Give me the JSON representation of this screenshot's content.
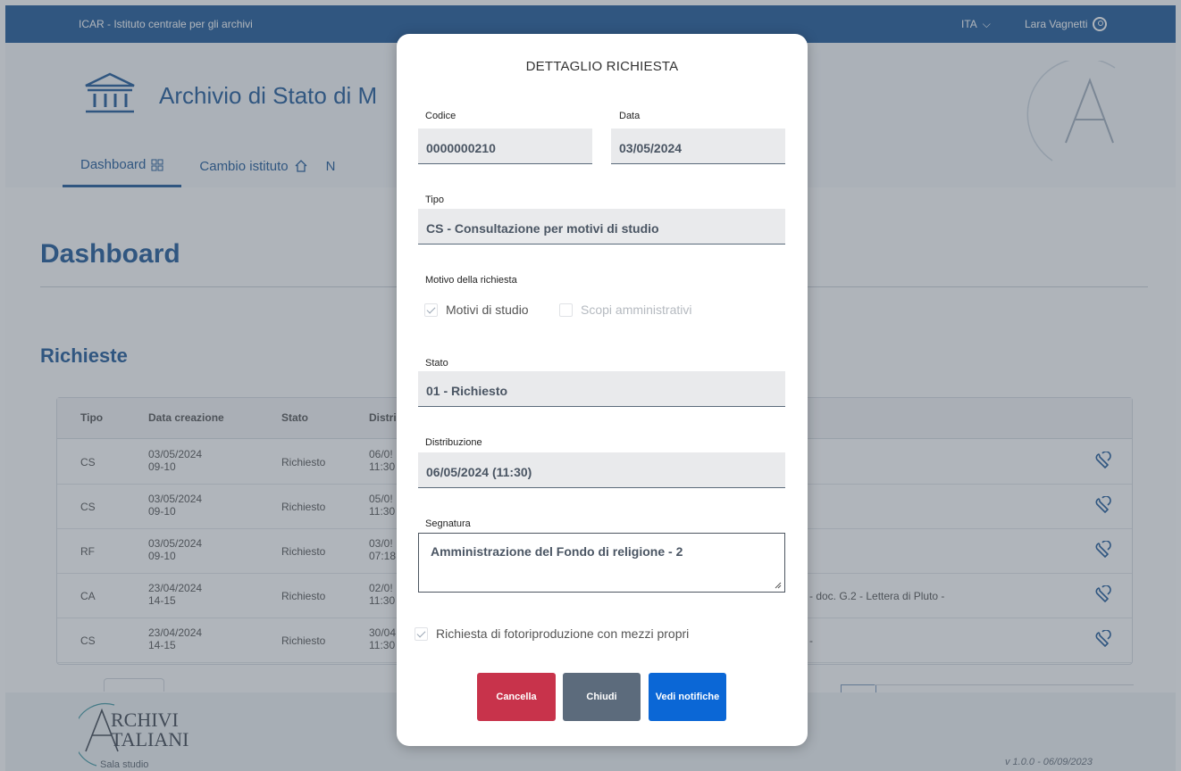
{
  "topbar": {
    "org": "ICAR - Istituto centrale per gli archivi",
    "lang": "ITA",
    "user": "Lara Vagnetti"
  },
  "header": {
    "institute": "Archivio di Stato di M"
  },
  "nav": [
    {
      "label": "Dashboard"
    },
    {
      "label": "Cambio istituto"
    },
    {
      "label": "N"
    }
  ],
  "page": {
    "title": "Dashboard",
    "section": "Richieste"
  },
  "table": {
    "headers": [
      "Tipo",
      "Data creazione",
      "Stato",
      "Distri"
    ],
    "rows": [
      {
        "tipo": "CS",
        "date": "03/05/2024",
        "time": "09-10",
        "stato": "Richiesto",
        "dist1": "06/0!",
        "dist2": "11:30",
        "extra": ""
      },
      {
        "tipo": "CS",
        "date": "03/05/2024",
        "time": "09-10",
        "stato": "Richiesto",
        "dist1": "05/0!",
        "dist2": "11:30",
        "extra": ""
      },
      {
        "tipo": "RF",
        "date": "03/05/2024",
        "time": "09-10",
        "stato": "Richiesto",
        "dist1": "03/0!",
        "dist2": "07:18",
        "extra": ""
      },
      {
        "tipo": "CA",
        "date": "23/04/2024",
        "time": "14-15",
        "stato": "Richiesto",
        "dist1": "02/0!",
        "dist2": "11:30",
        "extra": "- doc. G.2 - Lettera di Pluto -"
      },
      {
        "tipo": "CS",
        "date": "23/04/2024",
        "time": "14-15",
        "stato": "Richiesto",
        "dist1": "30/04",
        "dist2": "11:30",
        "extra": "-"
      }
    ]
  },
  "footer": {
    "logo_line1": "RCHIVI",
    "logo_line2": "TALIANI",
    "logo_sub": "Sala studio",
    "version": "v 1.0.0 - 06/09/2023"
  },
  "modal": {
    "title": "DETTAGLIO RICHIESTA",
    "codice_label": "Codice",
    "codice": "0000000210",
    "data_label": "Data",
    "data": "03/05/2024",
    "tipo_label": "Tipo",
    "tipo": "CS - Consultazione per motivi di studio",
    "motivo_label": "Motivo della richiesta",
    "motivo_studio": "Motivi di studio",
    "motivo_amm": "Scopi amministrativi",
    "stato_label": "Stato",
    "stato": "01 - Richiesto",
    "distribuzione_label": "Distribuzione",
    "distribuzione": "06/05/2024 (11:30)",
    "segnatura_label": "Segnatura",
    "segnatura": "Amministrazione del Fondo di religione - 2",
    "fotoriproduzione": "Richiesta di fotoriproduzione con mezzi propri",
    "btn_cancella": "Cancella",
    "btn_chiudi": "Chiudi",
    "btn_vedi": "Vedi notifiche"
  }
}
